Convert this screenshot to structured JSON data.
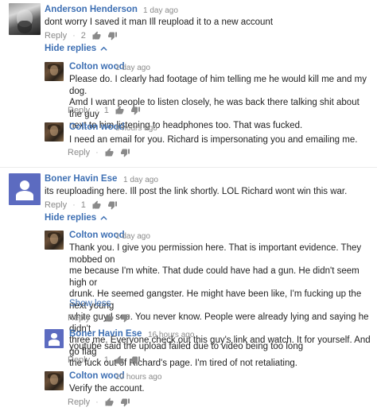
{
  "comments": [
    {
      "author": "Anderson Henderson",
      "time": "1 day ago",
      "text": "dont worry I saved it man Ill reupload it to a new account",
      "reply_label": "Reply",
      "likes": "2",
      "toggle_label": "Hide replies",
      "replies": [
        {
          "author": "Colton wood",
          "time": "1 day ago",
          "text_lines": [
            "Please do. I clearly had footage of him telling me he would kill me and my dog.",
            "Amd I want people to listen closely, he was back there talking shit about the guy",
            "next to him listening to headphones too. That was fucked."
          ],
          "reply_label": "Reply",
          "likes": "1"
        },
        {
          "author": "Colton wood",
          "time": "8 hours ago",
          "text_lines": [
            "I need an email for you. Richard is impersonating you and emailing me."
          ],
          "reply_label": "Reply",
          "likes": ""
        }
      ]
    },
    {
      "author": "Boner Havin Ese",
      "time": "1 day ago",
      "text": "its reuploading here. Ill post the link shortly. LOL Richard wont win this war.",
      "reply_label": "Reply",
      "likes": "1",
      "toggle_label": "Hide replies",
      "replies": [
        {
          "author": "Colton wood",
          "time": "1 day ago",
          "text_lines": [
            "Thank you. I give you permission here. That is important evidence. They mobbed on",
            "me because I'm white. That dude could have had a gun. He didn't seem high or",
            "drunk. He seemed gangster. He might have been like, I'm fucking up the next young",
            "white guy I see. You never know. People were already lying and saying he didn't",
            "three me. Everyone check out this guy's link and watch. It for yourself. And go flag",
            "the fuck out of Richard's page. I'm tired of not retaliating."
          ],
          "show_less": "Show less",
          "reply_label": "Reply",
          "likes": ""
        },
        {
          "author": "Boner Havin Ese",
          "time": "16 hours ago",
          "text_lines": [
            "youtube said the upload failed due to video being too long"
          ],
          "reply_label": "Reply",
          "likes": "1"
        },
        {
          "author": "Colton wood",
          "time": "10 hours ago",
          "text_lines": [
            "Verify the account."
          ],
          "reply_label": "Reply",
          "likes": ""
        }
      ]
    }
  ],
  "colors": {
    "link": "#3d6fb3",
    "meta": "#8a8a8a",
    "avatar_default": "#5c6bc0"
  },
  "icons": {
    "like": "thumbs-up-icon",
    "dislike": "thumbs-down-icon",
    "collapse": "chevron-up-icon"
  }
}
